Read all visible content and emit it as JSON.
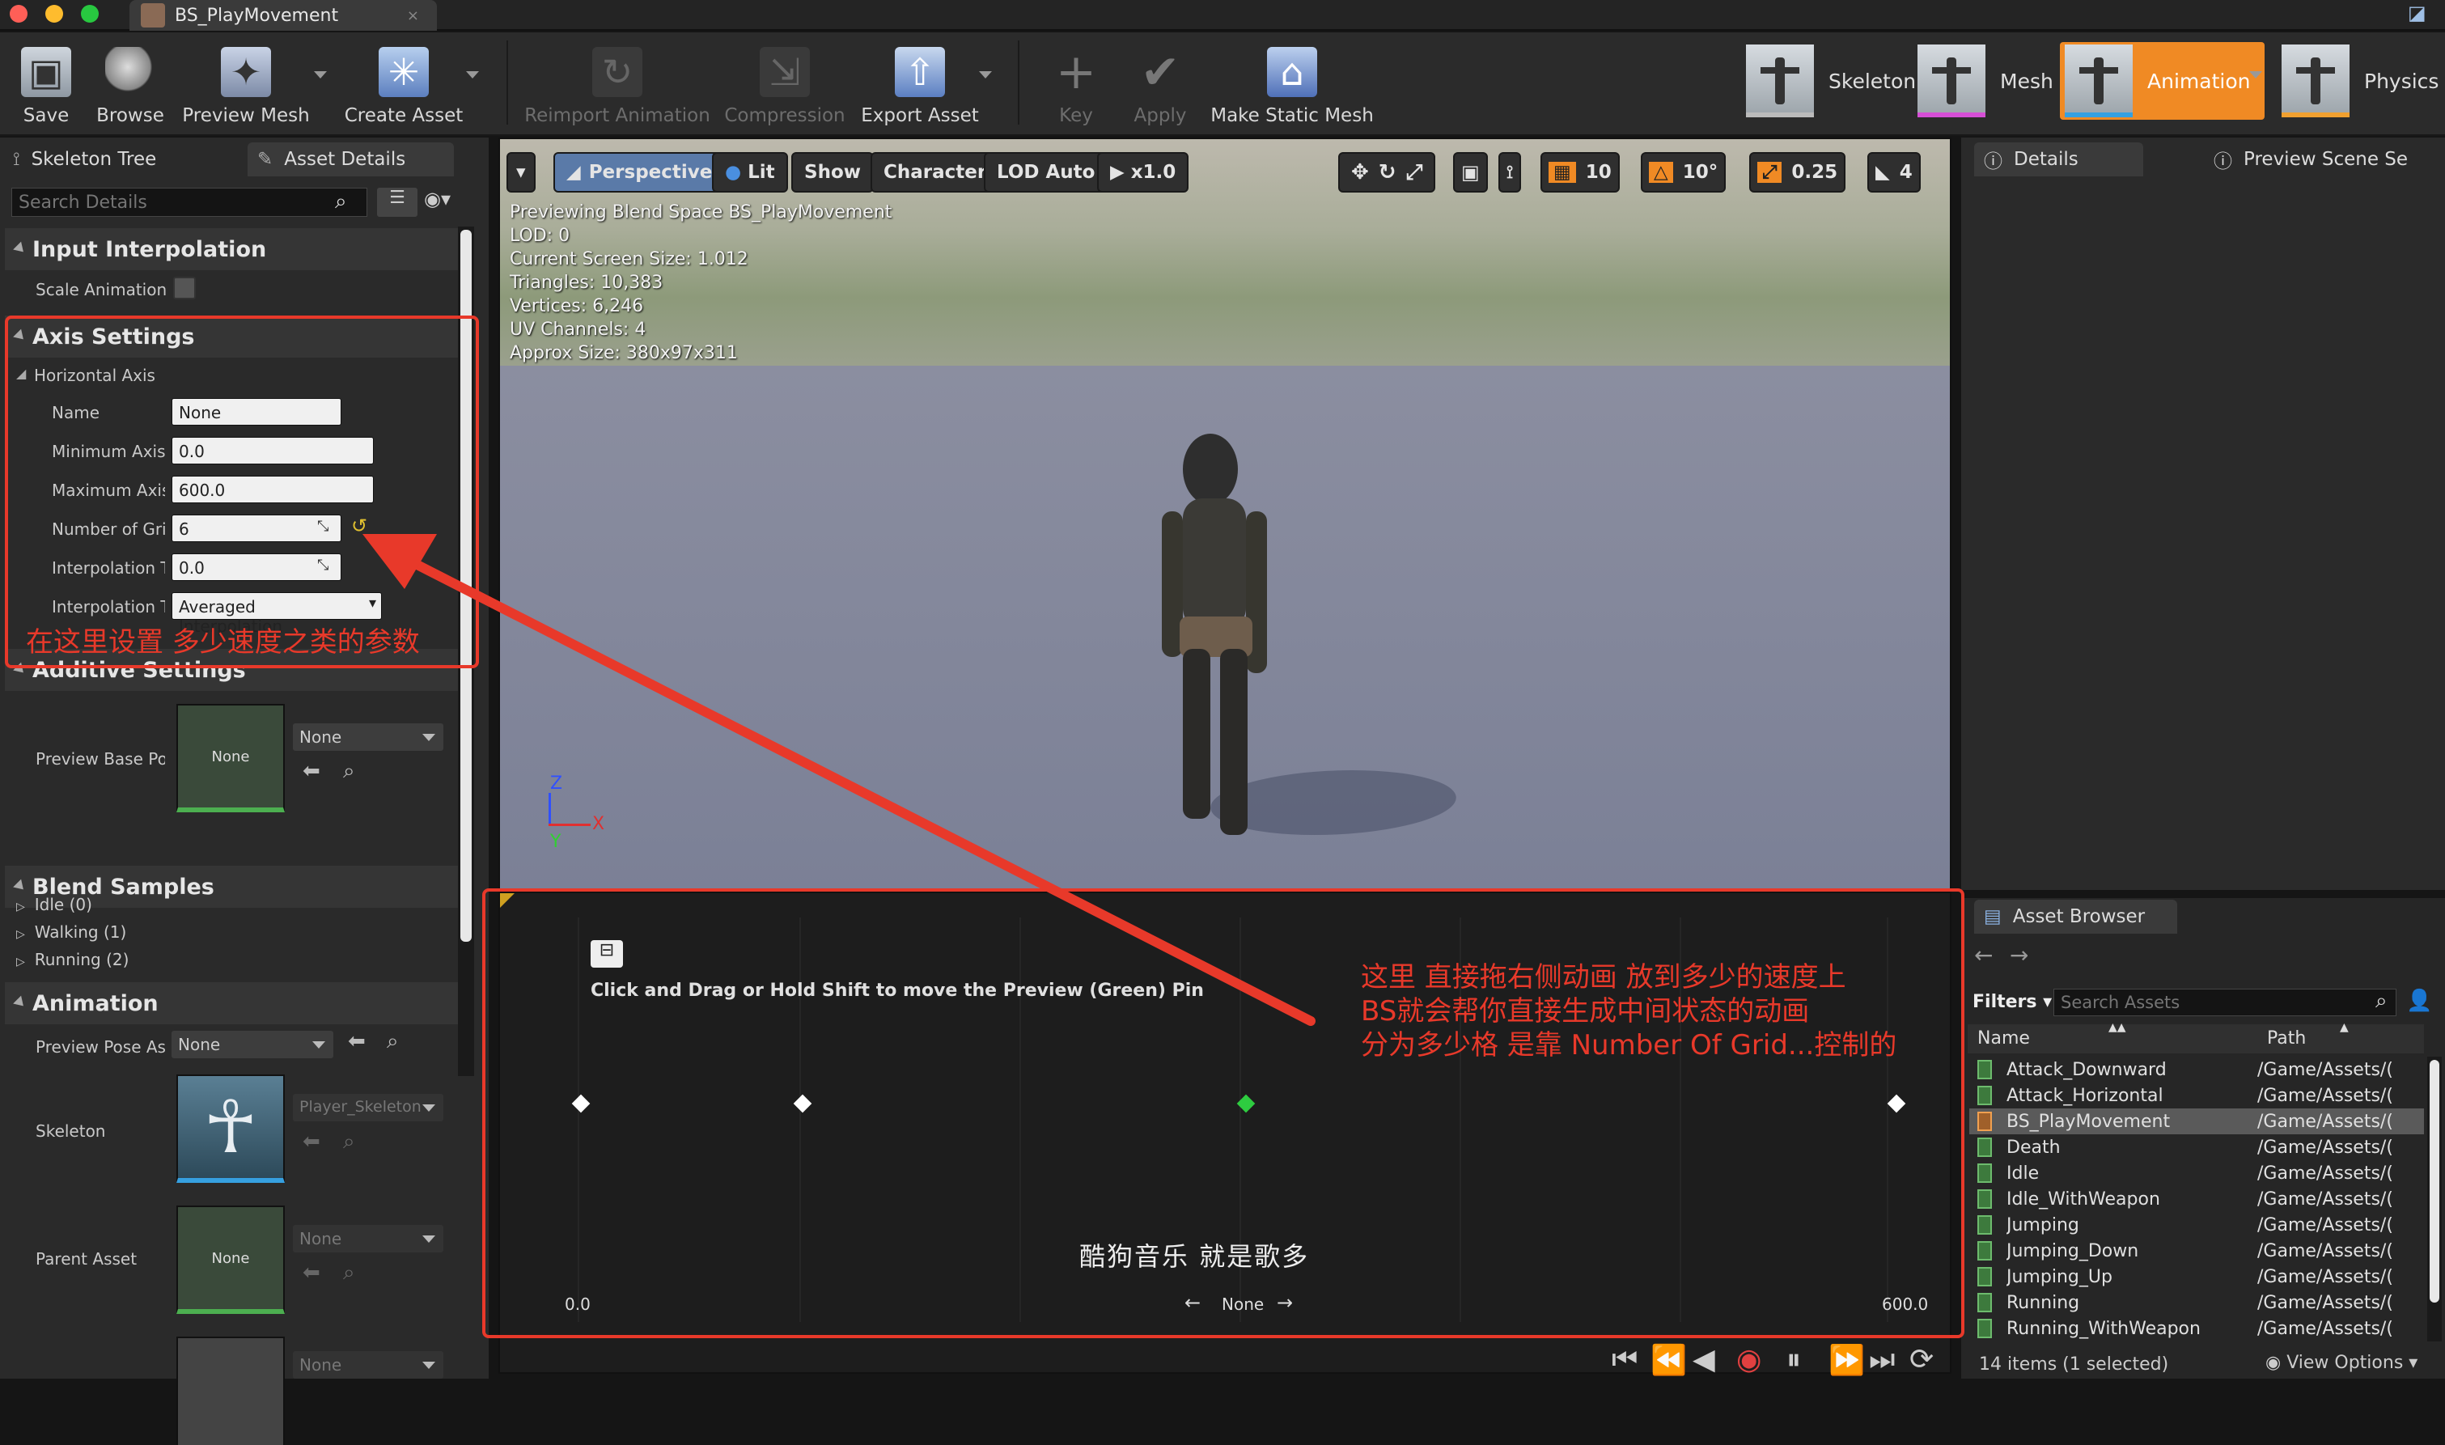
{
  "window": {
    "tab_title": "BS_PlayMovement"
  },
  "toolbar": {
    "save": "Save",
    "browse": "Browse",
    "preview_mesh": "Preview Mesh",
    "create_asset": "Create Asset",
    "reimport": "Reimport Animation",
    "compression": "Compression",
    "export_asset": "Export Asset",
    "key": "Key",
    "apply": "Apply",
    "make_static_mesh": "Make Static Mesh",
    "modes": {
      "skeleton": "Skeleton",
      "mesh": "Mesh",
      "animation": "Animation",
      "physics": "Physics"
    }
  },
  "left_panel": {
    "tabs": [
      "Skeleton Tree",
      "Asset Details"
    ],
    "search_placeholder": "Search Details",
    "input_interpolation": {
      "title": "Input Interpolation",
      "scale_animation": "Scale Animation"
    },
    "axis_settings": {
      "title": "Axis Settings",
      "horizontal_axis": "Horizontal Axis",
      "name_label": "Name",
      "name_value": "None",
      "min_label": "Minimum Axis",
      "min_value": "0.0",
      "max_label": "Maximum Axis",
      "max_value": "600.0",
      "grid_label": "Number of Grid",
      "grid_value": "6",
      "interp_time_label": "Interpolation T",
      "interp_time_value": "0.0",
      "interp_type_label": "Interpolation T",
      "interp_type_value": "Averaged Interpolation"
    },
    "additive_settings": {
      "title": "Additive Settings",
      "preview_base_label": "Preview Base Po",
      "thumb": "None",
      "dropdown": "None"
    },
    "blend_samples": {
      "title": "Blend Samples",
      "items": [
        "Idle (0)",
        "Walking (1)",
        "Running (2)"
      ]
    },
    "animation": {
      "title": "Animation",
      "preview_pose_label": "Preview Pose As",
      "preview_pose_value": "None",
      "skeleton_label": "Skeleton",
      "skeleton_value": "Player_Skeleton",
      "parent_label": "Parent Asset",
      "parent_thumb": "None",
      "parent_value": "None",
      "extra_value": "None"
    }
  },
  "viewport": {
    "buttons": {
      "perspective": "Perspective",
      "lit": "Lit",
      "show": "Show",
      "character": "Character",
      "lod": "LOD Auto",
      "speed": "x1.0"
    },
    "snap": {
      "grid": "10",
      "rot": "10°",
      "scale": "0.25",
      "cam": "4"
    },
    "info": [
      "Previewing Blend Space BS_PlayMovement",
      "LOD: 0",
      "Current Screen Size: 1.012",
      "Triangles: 10,383",
      "Vertices: 6,246",
      "UV Channels: 4",
      "Approx Size: 380x97x311"
    ],
    "axis_z": "Z",
    "axis_x": "X",
    "axis_y": "Y"
  },
  "graph": {
    "hint": "Click and Drag or Hold Shift to move the Preview (Green) Pin",
    "min_label": "0.0",
    "max_label": "600.0",
    "axis_name": "None",
    "arrow_left": "←",
    "arrow_right": "→",
    "watermark": "酷狗音乐  就是歌多"
  },
  "annotations": {
    "left_note": "在这里设置 多少速度之类的参数",
    "graph_note": [
      "这里 直接拖右侧动画 放到多少的速度上",
      "BS就会帮你直接生成中间状态的动画",
      "分为多少格 是靠 Number Of Grid...控制的"
    ]
  },
  "right_panel": {
    "tabs": [
      "Details",
      "Preview Scene Se"
    ]
  },
  "asset_browser": {
    "title": "Asset Browser",
    "filters": "Filters",
    "search_placeholder": "Search Assets",
    "col_name": "Name",
    "col_path": "Path",
    "items": [
      {
        "name": "Attack_Downward",
        "path": "/Game/Assets/("
      },
      {
        "name": "Attack_Horizontal",
        "path": "/Game/Assets/("
      },
      {
        "name": "BS_PlayMovement",
        "path": "/Game/Assets/("
      },
      {
        "name": "Death",
        "path": "/Game/Assets/("
      },
      {
        "name": "Idle",
        "path": "/Game/Assets/("
      },
      {
        "name": "Idle_WithWeapon",
        "path": "/Game/Assets/("
      },
      {
        "name": "Jumping",
        "path": "/Game/Assets/("
      },
      {
        "name": "Jumping_Down",
        "path": "/Game/Assets/("
      },
      {
        "name": "Jumping_Up",
        "path": "/Game/Assets/("
      },
      {
        "name": "Running",
        "path": "/Game/Assets/("
      },
      {
        "name": "Running_WithWeapon",
        "path": "/Game/Assets/("
      }
    ],
    "status": "14 items (1 selected)",
    "view_options": "View Options"
  },
  "colors": {
    "accent_orange": "#f08a24",
    "annotation_red": "#e8392a",
    "preview_pin": "#2ecc40"
  }
}
